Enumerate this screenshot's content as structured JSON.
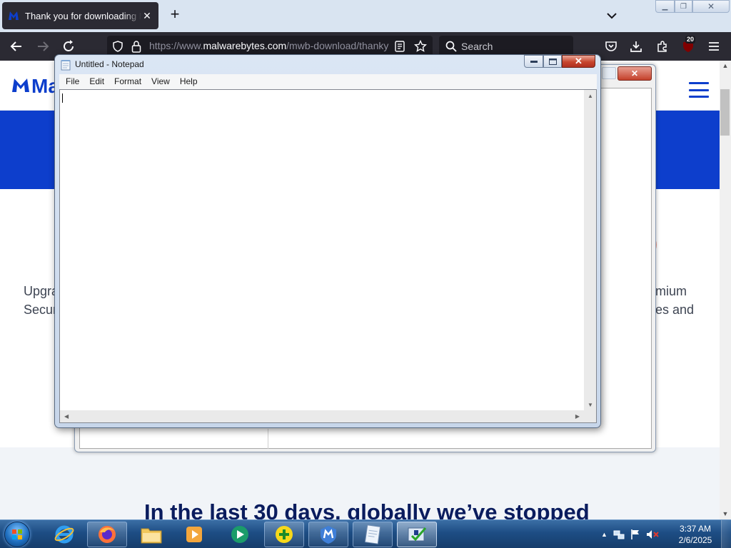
{
  "browser": {
    "tab_title": "Thank you for downloading Malwarebytes",
    "url_prefix": "https://www.",
    "url_domain": "malwarebytes.com",
    "url_path": "/mwb-download/thankyou/",
    "search_placeholder": "Search",
    "extension_badge": "20"
  },
  "page": {
    "logo_text": "Malwarebytes",
    "promo_left_line1": "Upgrade to Premium",
    "promo_left_line2": "Security",
    "promo_right_line1": "mium",
    "promo_right_line2": "es and",
    "stats_heading": "In the last 30 days, globally we’ve stopped"
  },
  "notepad": {
    "title": "Untitled - Notepad",
    "menu": [
      "File",
      "Edit",
      "Format",
      "View",
      "Help"
    ],
    "content": ""
  },
  "taskbar": {
    "apps": [
      "internet-explorer",
      "firefox",
      "file-explorer",
      "media-player",
      "media-center",
      "plus-app",
      "malwarebytes",
      "notepad",
      "installer"
    ],
    "time": "3:37 AM",
    "date": "2/6/2025"
  },
  "colors": {
    "brand_blue": "#0d3ecc",
    "heading_navy": "#0a1c5e",
    "firefox_dark": "#2b2a33",
    "close_red": "#c7452d"
  }
}
